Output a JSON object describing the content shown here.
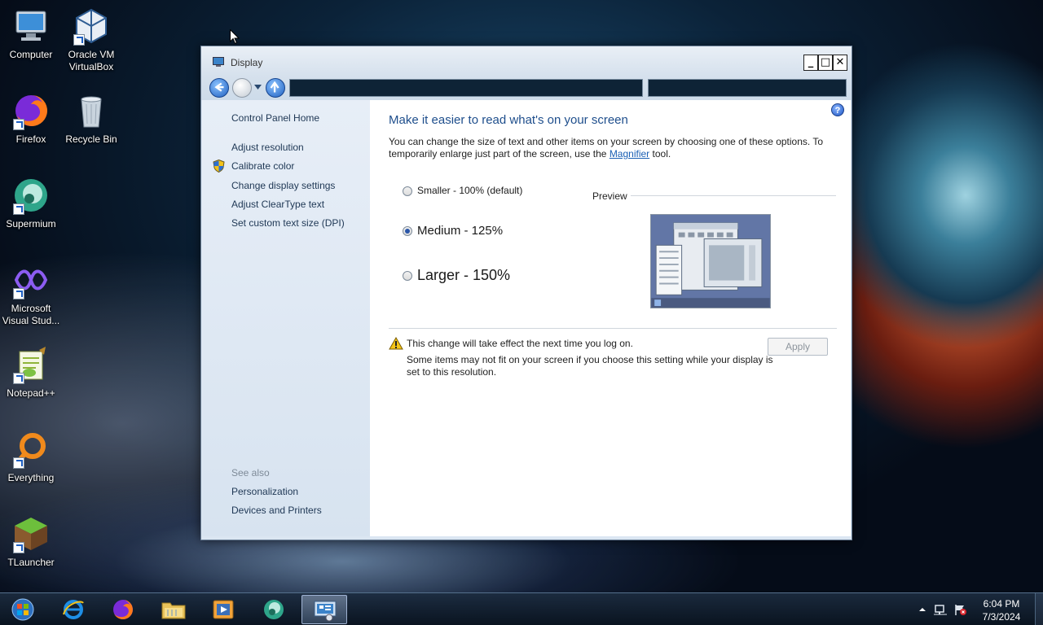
{
  "desktop_icons": [
    {
      "label": "Computer",
      "icon": "computer-icon"
    },
    {
      "label": "Oracle VM VirtualBox",
      "icon": "virtualbox-icon"
    },
    {
      "label": "Firefox",
      "icon": "firefox-icon"
    },
    {
      "label": "Recycle Bin",
      "icon": "recycle-bin-icon"
    },
    {
      "label": "Supermium",
      "icon": "supermium-icon"
    },
    {
      "label": "Microsoft Visual Stud...",
      "icon": "visual-studio-icon"
    },
    {
      "label": "Notepad++",
      "icon": "notepad-plus-plus-icon"
    },
    {
      "label": "Everything",
      "icon": "everything-icon"
    },
    {
      "label": "TLauncher",
      "icon": "tlauncher-icon"
    }
  ],
  "window": {
    "title": "Display",
    "controls": {
      "minimize": "_",
      "maximize": "□",
      "close": "✕"
    }
  },
  "sidebar": {
    "home": "Control Panel Home",
    "links": [
      "Adjust resolution",
      "Calibrate color",
      "Change display settings",
      "Adjust ClearType text",
      "Set custom text size (DPI)"
    ],
    "see_also_label": "See also",
    "see_also": [
      "Personalization",
      "Devices and Printers"
    ]
  },
  "content": {
    "help": "?",
    "heading": "Make it easier to read what's on your screen",
    "description_pre": "You can change the size of text and other items on your screen by choosing one of these options. To temporarily enlarge just part of the screen, use the ",
    "description_link": "Magnifier",
    "description_post": " tool.",
    "options": [
      {
        "label": "Smaller - 100% (default)",
        "checked": false
      },
      {
        "label": "Medium - 125%",
        "checked": true
      },
      {
        "label": "Larger - 150%",
        "checked": false
      }
    ],
    "preview_label": "Preview",
    "warning": "This change will take effect the next time you log on.",
    "warning_detail": "Some items may not fit on your screen if you choose this setting while your display is set to this resolution.",
    "apply_label": "Apply"
  },
  "taskbar": {
    "apps": [
      "start-orb-icon",
      "internet-explorer-icon",
      "firefox-icon",
      "file-explorer-icon",
      "media-player-icon",
      "supermium-icon",
      "display-control-panel-icon"
    ],
    "time": "6:04 PM",
    "date": "7/3/2024"
  }
}
